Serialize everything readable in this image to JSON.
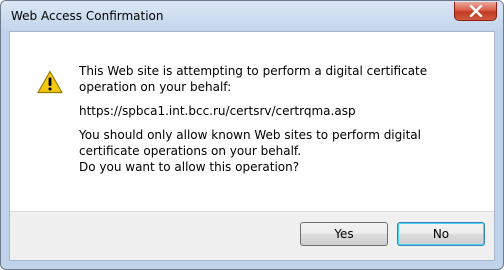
{
  "window": {
    "title": "Web Access Confirmation"
  },
  "message": {
    "line1": "This Web site is attempting to perform a digital certificate operation on your behalf:",
    "url": "https://spbca1.int.bcc.ru/certsrv/certrqma.asp",
    "warning": "You should only allow known Web sites to perform digital certificate operations on your behalf.",
    "question": "Do you want to allow this operation?"
  },
  "buttons": {
    "yes_label": "Yes",
    "no_label": "No"
  },
  "icons": {
    "close": "close-icon",
    "warning": "warning-icon"
  },
  "colors": {
    "warning_yellow": "#f2c811",
    "close_red": "#c9432c",
    "focus_blue": "#3c7fb1"
  }
}
